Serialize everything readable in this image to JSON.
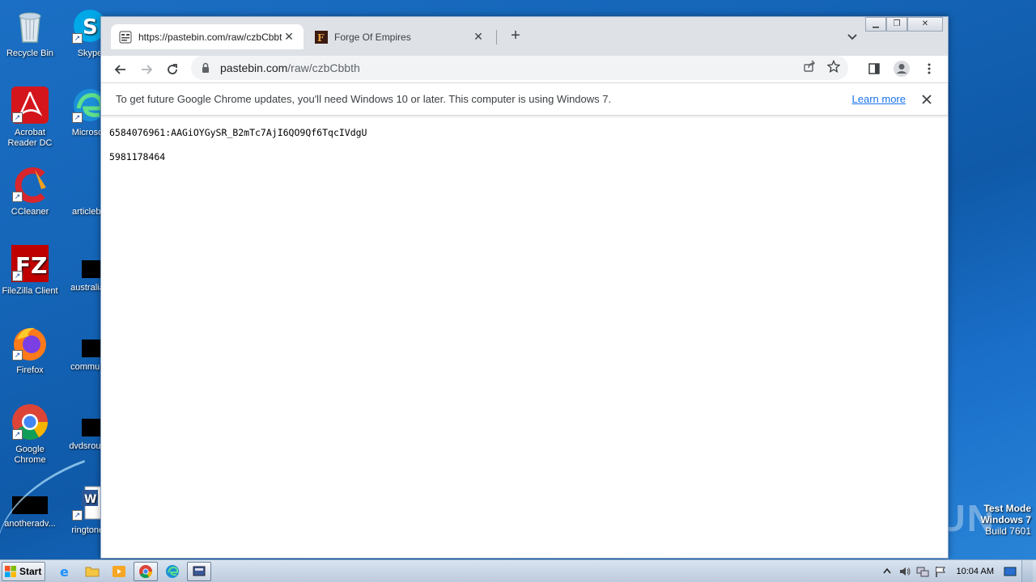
{
  "desktop": {
    "icons_col1": [
      {
        "label": "Recycle Bin"
      },
      {
        "label": "Acrobat Reader DC"
      },
      {
        "label": "CCleaner"
      },
      {
        "label": "FileZilla Client"
      },
      {
        "label": "Firefox"
      },
      {
        "label": "Google Chrome"
      },
      {
        "label": "anotheradv..."
      }
    ],
    "icons_col2": [
      {
        "label": "Skype"
      },
      {
        "label": "Microsoft"
      },
      {
        "label": "articlebig"
      },
      {
        "label": "australian"
      },
      {
        "label": "communit"
      },
      {
        "label": "dvdsround"
      },
      {
        "label": "ringtones"
      }
    ],
    "watermark": "ANY RUN",
    "testmode": {
      "line1": "Test Mode",
      "line2": "Windows 7",
      "line3": "Build 7601"
    }
  },
  "browser": {
    "tabs": [
      {
        "title": "https://pastebin.com/raw/czbCbbth",
        "active": true
      },
      {
        "title": "Forge Of Empires",
        "active": false
      }
    ],
    "new_tab_label": "+",
    "address": {
      "host": "pastebin.com",
      "path": "/raw/czbCbbth"
    },
    "infobar": {
      "message": "To get future Google Chrome updates, you'll need Windows 10 or later. This computer is using Windows 7.",
      "link": "Learn more"
    },
    "content_lines": [
      "6584076961:AAGiOYGySR_B2mTc7AjI6QO9Qf6TqcIVdgU",
      "5981178464"
    ]
  },
  "taskbar": {
    "start_label": "Start",
    "clock": "10:04 AM"
  },
  "colors": {
    "desktop_bg": "#1565b8",
    "link": "#1a73e8"
  }
}
